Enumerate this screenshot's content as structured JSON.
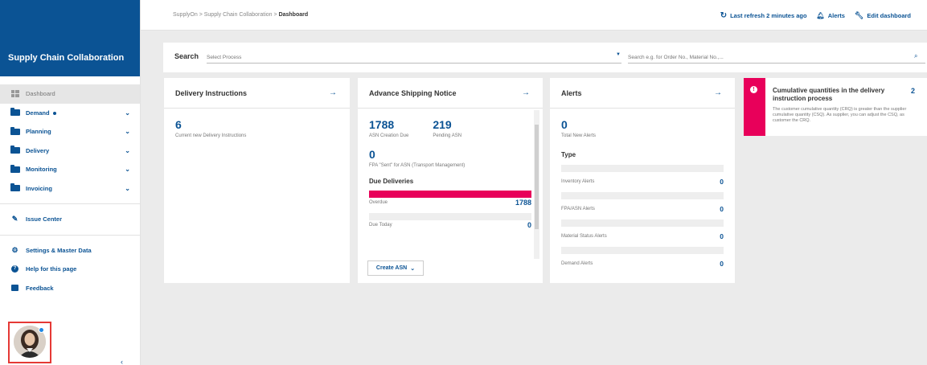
{
  "sidebar": {
    "title": "Supply Chain Collaboration",
    "items": [
      {
        "label": "Dashboard"
      },
      {
        "label": "Demand"
      },
      {
        "label": "Planning"
      },
      {
        "label": "Delivery"
      },
      {
        "label": "Monitoring"
      },
      {
        "label": "Invoicing"
      }
    ],
    "issue_center": "Issue Center",
    "settings": "Settings & Master Data",
    "help": "Help for this page",
    "feedback": "Feedback",
    "collapse": "‹"
  },
  "topbar": {
    "breadcrumb": [
      "SupplyOn",
      "Supply Chain Collaboration",
      "Dashboard"
    ],
    "refresh": "Last refresh 2 minutes ago",
    "alerts": "Alerts",
    "edit": "Edit dashboard"
  },
  "search": {
    "label": "Search",
    "process_placeholder": "Select Process",
    "order_placeholder": "Search e.g. for Order No., Material No.,..."
  },
  "delivery_card": {
    "title": "Delivery Instructions",
    "count": "6",
    "count_label": "Current new Delivery Instructions"
  },
  "asn_card": {
    "title": "Advance Shipping Notice",
    "creation_due": "1788",
    "creation_due_label": "ASN Creation Due",
    "pending": "219",
    "pending_label": "Pending ASN",
    "fpa_count": "0",
    "fpa_label": "FPA \"Sent\" for ASN (Transport Management)",
    "due_title": "Due Deliveries",
    "overdue_label": "Overdue",
    "overdue_value": "1788",
    "due_today_label": "Due Today",
    "due_today_value": "0",
    "create_button": "Create ASN"
  },
  "alerts_card": {
    "title": "Alerts",
    "total": "0",
    "total_label": "Total New Alerts",
    "type_title": "Type",
    "rows": [
      {
        "label": "Inventory Alerts",
        "value": "0"
      },
      {
        "label": "FPA/ASN Alerts",
        "value": "0"
      },
      {
        "label": "Material Status Alerts",
        "value": "0"
      },
      {
        "label": "Demand Alerts",
        "value": "0"
      }
    ]
  },
  "info_card": {
    "title": "Cumulative quantities in the delivery instruction process",
    "count": "2",
    "text": "The customer cumulative quantity (CRQ) is greater than the supplier cumulative quantity (CSQ). As supplier, you can adjust the CSQ, as customer the CRQ."
  },
  "colors": {
    "brand": "#0b5394",
    "accent": "#e8005a"
  }
}
